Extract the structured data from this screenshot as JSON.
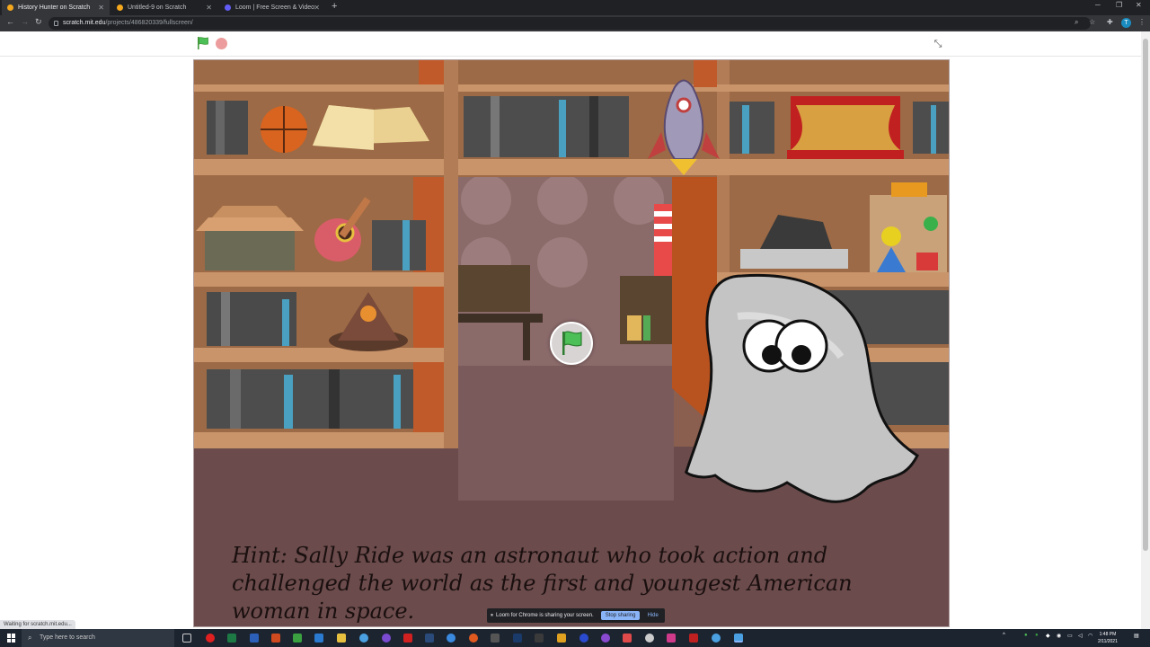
{
  "browser": {
    "tabs": [
      {
        "title": "History Hunter on Scratch",
        "active": true
      },
      {
        "title": "Untitled-9 on Scratch",
        "active": false
      },
      {
        "title": "Loom | Free Screen & Video",
        "active": false
      }
    ],
    "url_host": "scratch.mit.edu",
    "url_path": "/projects/486820339/fullscreen/",
    "profile_initial": "T",
    "status_text": "Waiting for scratch.mit.edu..."
  },
  "player": {
    "green_flag_icon": "green-flag-icon",
    "stop_icon": "stop-icon",
    "fullscreen_icon": "exit-fullscreen-icon"
  },
  "stage": {
    "hint": "Hint: Sally Ride was an astronaut who took action and challenged the world as the first and youngest American  woman in space."
  },
  "loom_notice": {
    "message": "Loom for Chrome is sharing your screen.",
    "stop_label": "Stop sharing",
    "hide_label": "Hide"
  },
  "taskbar": {
    "search_placeholder": "Type here to search",
    "time": "1:48 PM",
    "date": "2/11/2021"
  },
  "colors": {
    "scratch_flag_green": "#4cbf56",
    "stop_red": "#ec9c9c",
    "stage_floor": "#6b4b4b"
  }
}
